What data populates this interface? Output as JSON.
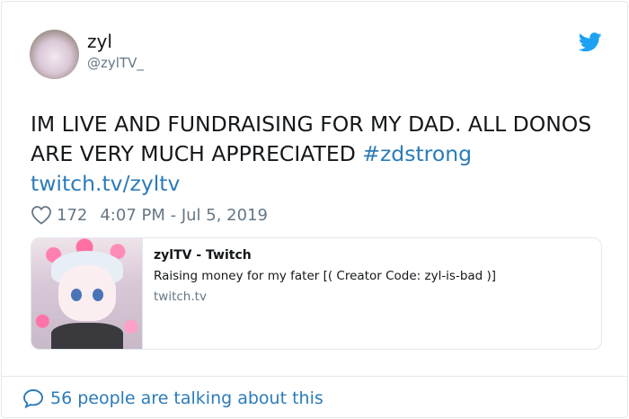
{
  "author": {
    "name": "zyl",
    "handle": "@zylTV_"
  },
  "tweet": {
    "text": "IM LIVE AND FUNDRAISING FOR MY DAD. ALL DONOS ARE VERY MUCH APPRECIATED ",
    "hashtag": "#zdstrong",
    "url": "twitch.tv/zyltv"
  },
  "meta": {
    "likes": "172",
    "timestamp": "4:07 PM - Jul 5, 2019"
  },
  "link_card": {
    "title": "zylTV - Twitch",
    "description": "Raising money for my fater [( Creator Code: zyl-is-bad )]",
    "domain": "twitch.tv"
  },
  "footer": {
    "talking": "56 people are talking about this"
  },
  "icons": {
    "brand": "twitter-bird-icon",
    "like": "heart-icon",
    "reply": "speech-bubble-icon"
  },
  "colors": {
    "link": "#2b7bb9",
    "brand": "#1da1f2",
    "muted": "#657786",
    "border": "#e1e8ed"
  }
}
